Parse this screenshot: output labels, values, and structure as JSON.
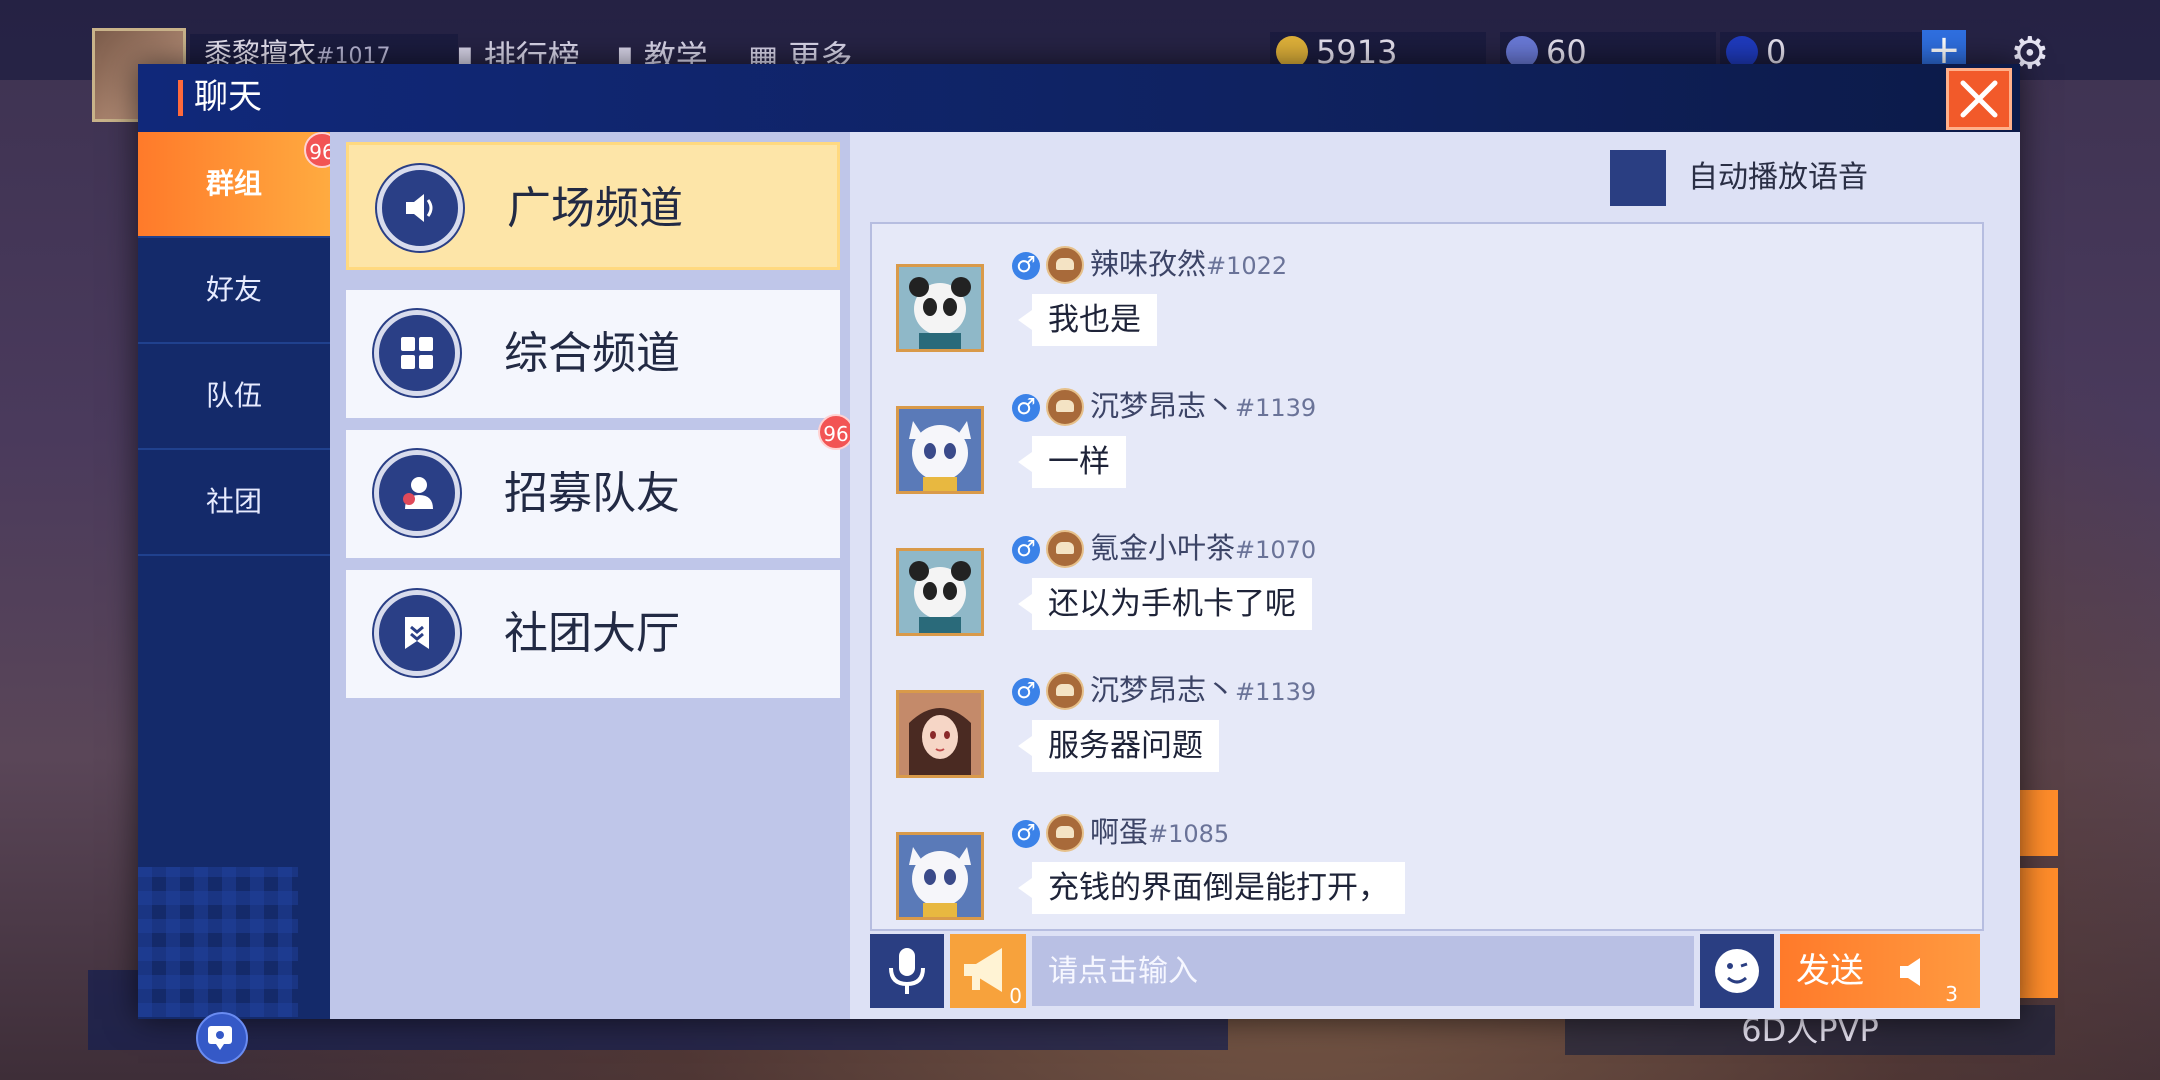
{
  "hud": {
    "player_name": "黍黎擅衣",
    "player_id": "#1017",
    "menu": [
      "排行榜",
      "教学",
      "更多"
    ],
    "gold": "5913",
    "diamond": "60",
    "orb": "0",
    "pvp_label": "6D人PVP"
  },
  "modal": {
    "title": "聊天",
    "close_icon": "close-icon"
  },
  "left_tabs": [
    {
      "label": "群组",
      "active": true,
      "badge": "96"
    },
    {
      "label": "好友",
      "active": false
    },
    {
      "label": "队伍",
      "active": false
    },
    {
      "label": "社团",
      "active": false
    }
  ],
  "channels": [
    {
      "label": "广场频道",
      "icon": "speaker-icon",
      "active": true
    },
    {
      "label": "综合频道",
      "icon": "grid-icon",
      "active": false
    },
    {
      "label": "招募队友",
      "icon": "people-icon",
      "active": false,
      "badge": "96"
    },
    {
      "label": "社团大厅",
      "icon": "banner-icon",
      "active": false
    }
  ],
  "auto_voice": {
    "label": "自动播放语音",
    "checked": false
  },
  "messages": [
    {
      "name": "辣味孜然",
      "id": "#1022",
      "text": "我也是",
      "avatar": "panda",
      "gender": "♂"
    },
    {
      "name": "沉梦昂志丶",
      "id": "#1139",
      "text": "一样",
      "avatar": "tiger",
      "gender": "♂"
    },
    {
      "name": "氪金小叶茶",
      "id": "#1070",
      "text": "还以为手机卡了呢",
      "avatar": "panda",
      "gender": "♂"
    },
    {
      "name": "沉梦昂志丶",
      "id": "#1139",
      "text": "服务器问题",
      "avatar": "girl",
      "gender": "♂"
    },
    {
      "name": "啊蛋",
      "id": "#1085",
      "text": "充钱的界面倒是能打开，",
      "avatar": "tiger",
      "gender": "♂"
    }
  ],
  "input": {
    "placeholder": "请点击输入",
    "horn_count": "0",
    "send_label": "发送",
    "send_count": "3"
  },
  "colors": {
    "accent_orange": "#ff7a2a",
    "navy": "#1a2e6e",
    "channel_active": "#fde5a8"
  }
}
